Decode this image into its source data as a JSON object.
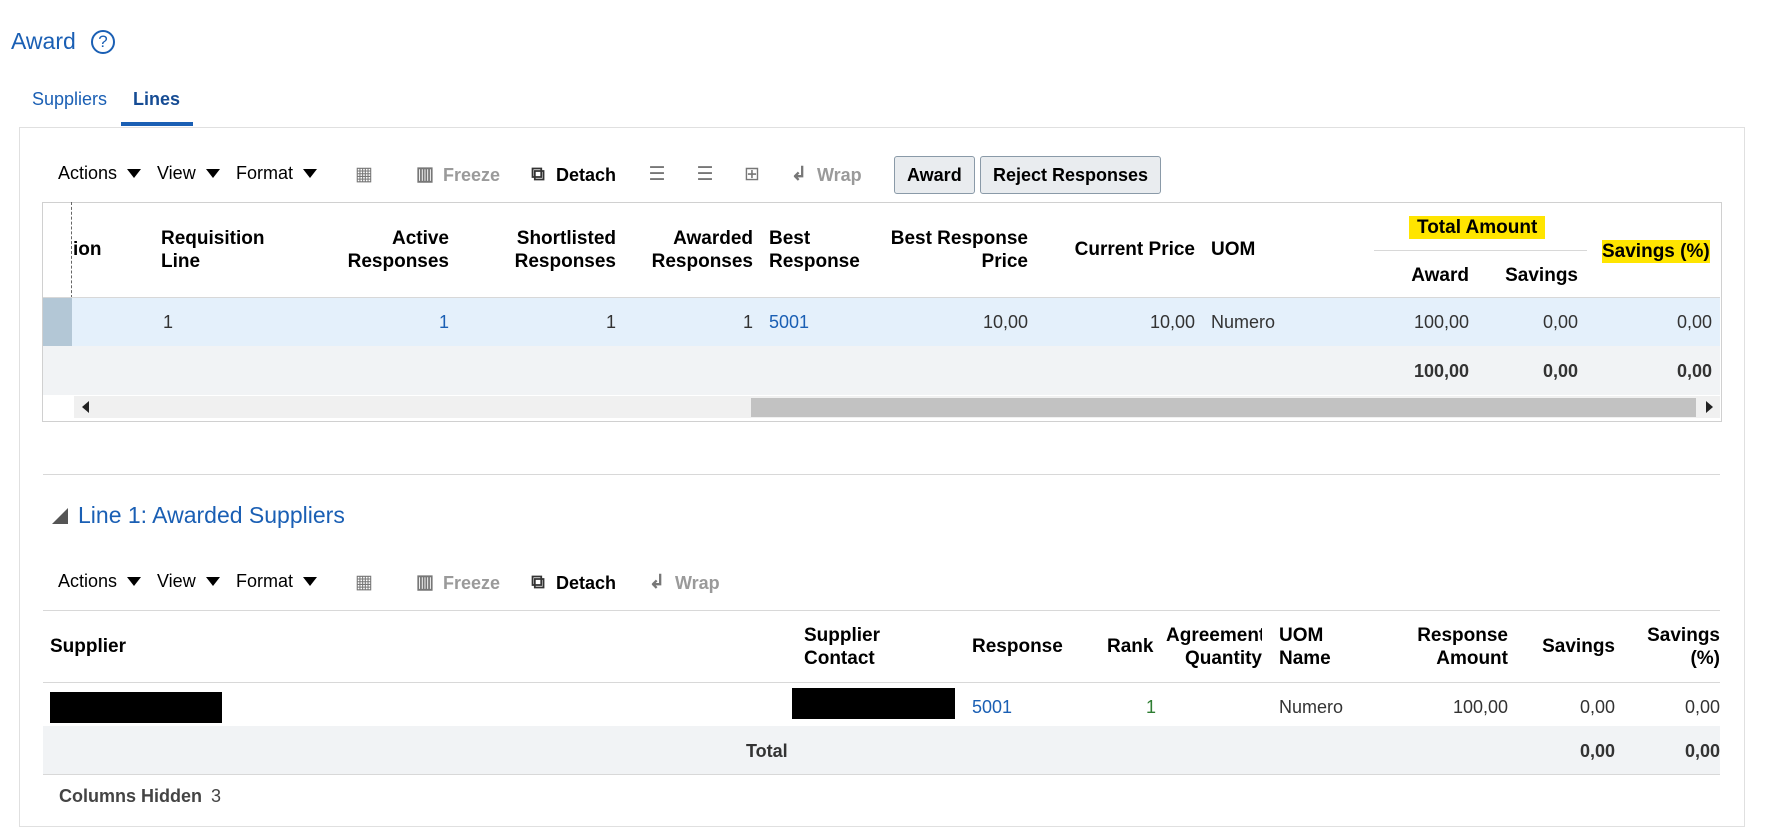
{
  "page": {
    "title": "Award",
    "help_icon": "?"
  },
  "tabs": [
    {
      "label": "Suppliers"
    },
    {
      "label": "Lines"
    }
  ],
  "toolbar_top": {
    "actions": "Actions",
    "view": "View",
    "format": "Format",
    "freeze": "Freeze",
    "detach": "Detach",
    "wrap": "Wrap",
    "award_button": "Award",
    "reject_button": "Reject Responses"
  },
  "lines_table": {
    "headers": {
      "description_partial": "ion",
      "requisition_line": "Requisition Line",
      "active_responses": "Active Responses",
      "shortlisted_responses": "Shortlisted Responses",
      "awarded_responses": "Awarded Responses",
      "best_response": "Best Response",
      "best_response_price": "Best Response Price",
      "current_price": "Current Price",
      "uom": "UOM",
      "total_amount": "Total Amount",
      "award": "Award",
      "savings": "Savings",
      "savings_pct": "Savings (%)"
    },
    "row": {
      "requisition_line": "1",
      "active_responses": "1",
      "shortlisted_responses": "1",
      "awarded_responses": "1",
      "best_response": "5001",
      "best_response_price": "10,00",
      "current_price": "10,00",
      "uom": "Numero",
      "award": "100,00",
      "savings": "0,00",
      "savings_pct": "0,00"
    },
    "totals": {
      "award": "100,00",
      "savings": "0,00",
      "savings_pct": "0,00"
    }
  },
  "section": {
    "title": "Line 1: Awarded Suppliers"
  },
  "toolbar_bottom": {
    "actions": "Actions",
    "view": "View",
    "format": "Format",
    "freeze": "Freeze",
    "detach": "Detach",
    "wrap": "Wrap"
  },
  "suppliers_table": {
    "headers": {
      "supplier": "Supplier",
      "supplier_contact": "Supplier Contact",
      "response": "Response",
      "rank": "Rank",
      "agreement_quantity": "Agreement Quantity",
      "uom_name": "UOM Name",
      "response_amount": "Response Amount",
      "savings": "Savings",
      "savings_pct": "Savings (%)"
    },
    "row": {
      "response": "5001",
      "rank": "1",
      "uom_name": "Numero",
      "response_amount": "100,00",
      "savings": "0,00",
      "savings_pct": "0,00"
    },
    "total_label": "Total",
    "totals": {
      "savings": "0,00",
      "savings_pct": "0,00"
    }
  },
  "footer": {
    "columns_hidden_label": "Columns Hidden",
    "columns_hidden_count": "3"
  }
}
